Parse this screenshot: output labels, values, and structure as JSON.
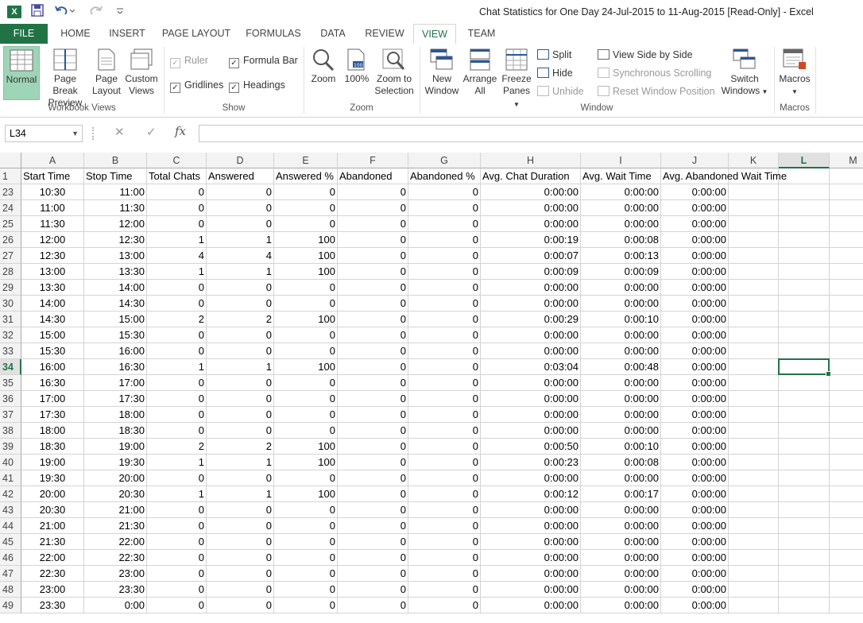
{
  "window": {
    "title": "Chat Statistics for One Day 24-Jul-2015 to 11-Aug-2015  [Read-Only] - Excel",
    "app_icon": "X"
  },
  "tabs": [
    "FILE",
    "HOME",
    "INSERT",
    "PAGE LAYOUT",
    "FORMULAS",
    "DATA",
    "REVIEW",
    "VIEW",
    "TEAM"
  ],
  "active_tab": "VIEW",
  "ribbon": {
    "workbook_views": {
      "label": "Workbook Views",
      "normal": "Normal",
      "page_break_1": "Page Break",
      "page_break_2": "Preview",
      "page_layout_1": "Page",
      "page_layout_2": "Layout",
      "custom_views_1": "Custom",
      "custom_views_2": "Views"
    },
    "show": {
      "label": "Show",
      "ruler": "Ruler",
      "gridlines": "Gridlines",
      "formula_bar": "Formula Bar",
      "headings": "Headings"
    },
    "zoom": {
      "label": "Zoom",
      "zoom": "Zoom",
      "zoom100": "100%",
      "zoom_sel_1": "Zoom to",
      "zoom_sel_2": "Selection"
    },
    "window": {
      "label": "Window",
      "new_1": "New",
      "new_2": "Window",
      "arrange_1": "Arrange",
      "arrange_2": "All",
      "freeze_1": "Freeze",
      "freeze_2": "Panes",
      "split": "Split",
      "hide": "Hide",
      "unhide": "Unhide",
      "side_by_side": "View Side by Side",
      "sync_scroll": "Synchronous Scrolling",
      "reset_pos": "Reset Window Position",
      "switch_1": "Switch",
      "switch_2": "Windows"
    },
    "macros": {
      "label": "Macros",
      "macros": "Macros"
    }
  },
  "formula_bar": {
    "name_box": "L34",
    "fx": "fx",
    "formula": ""
  },
  "columns": [
    "A",
    "B",
    "C",
    "D",
    "E",
    "F",
    "G",
    "H",
    "I",
    "J",
    "K",
    "L",
    "M"
  ],
  "selected_column": "L",
  "selected_row": "34",
  "header_row": {
    "row": "1",
    "cells": [
      "Start Time",
      "Stop Time",
      "Total Chats",
      "Answered",
      "Answered %",
      "Abandoned",
      "Abandoned %",
      "Avg. Chat Duration",
      "Avg. Wait Time",
      "Avg. Abandoned Wait Time"
    ]
  },
  "rows": [
    {
      "n": "23",
      "v": [
        "10:30",
        "11:00",
        "0",
        "0",
        "0",
        "0",
        "0",
        "0:00:00",
        "0:00:00",
        "0:00:00"
      ]
    },
    {
      "n": "24",
      "v": [
        "11:00",
        "11:30",
        "0",
        "0",
        "0",
        "0",
        "0",
        "0:00:00",
        "0:00:00",
        "0:00:00"
      ]
    },
    {
      "n": "25",
      "v": [
        "11:30",
        "12:00",
        "0",
        "0",
        "0",
        "0",
        "0",
        "0:00:00",
        "0:00:00",
        "0:00:00"
      ]
    },
    {
      "n": "26",
      "v": [
        "12:00",
        "12:30",
        "1",
        "1",
        "100",
        "0",
        "0",
        "0:00:19",
        "0:00:08",
        "0:00:00"
      ]
    },
    {
      "n": "27",
      "v": [
        "12:30",
        "13:00",
        "4",
        "4",
        "100",
        "0",
        "0",
        "0:00:07",
        "0:00:13",
        "0:00:00"
      ]
    },
    {
      "n": "28",
      "v": [
        "13:00",
        "13:30",
        "1",
        "1",
        "100",
        "0",
        "0",
        "0:00:09",
        "0:00:09",
        "0:00:00"
      ]
    },
    {
      "n": "29",
      "v": [
        "13:30",
        "14:00",
        "0",
        "0",
        "0",
        "0",
        "0",
        "0:00:00",
        "0:00:00",
        "0:00:00"
      ]
    },
    {
      "n": "30",
      "v": [
        "14:00",
        "14:30",
        "0",
        "0",
        "0",
        "0",
        "0",
        "0:00:00",
        "0:00:00",
        "0:00:00"
      ]
    },
    {
      "n": "31",
      "v": [
        "14:30",
        "15:00",
        "2",
        "2",
        "100",
        "0",
        "0",
        "0:00:29",
        "0:00:10",
        "0:00:00"
      ]
    },
    {
      "n": "32",
      "v": [
        "15:00",
        "15:30",
        "0",
        "0",
        "0",
        "0",
        "0",
        "0:00:00",
        "0:00:00",
        "0:00:00"
      ]
    },
    {
      "n": "33",
      "v": [
        "15:30",
        "16:00",
        "0",
        "0",
        "0",
        "0",
        "0",
        "0:00:00",
        "0:00:00",
        "0:00:00"
      ]
    },
    {
      "n": "34",
      "v": [
        "16:00",
        "16:30",
        "1",
        "1",
        "100",
        "0",
        "0",
        "0:03:04",
        "0:00:48",
        "0:00:00"
      ]
    },
    {
      "n": "35",
      "v": [
        "16:30",
        "17:00",
        "0",
        "0",
        "0",
        "0",
        "0",
        "0:00:00",
        "0:00:00",
        "0:00:00"
      ]
    },
    {
      "n": "36",
      "v": [
        "17:00",
        "17:30",
        "0",
        "0",
        "0",
        "0",
        "0",
        "0:00:00",
        "0:00:00",
        "0:00:00"
      ]
    },
    {
      "n": "37",
      "v": [
        "17:30",
        "18:00",
        "0",
        "0",
        "0",
        "0",
        "0",
        "0:00:00",
        "0:00:00",
        "0:00:00"
      ]
    },
    {
      "n": "38",
      "v": [
        "18:00",
        "18:30",
        "0",
        "0",
        "0",
        "0",
        "0",
        "0:00:00",
        "0:00:00",
        "0:00:00"
      ]
    },
    {
      "n": "39",
      "v": [
        "18:30",
        "19:00",
        "2",
        "2",
        "100",
        "0",
        "0",
        "0:00:50",
        "0:00:10",
        "0:00:00"
      ]
    },
    {
      "n": "40",
      "v": [
        "19:00",
        "19:30",
        "1",
        "1",
        "100",
        "0",
        "0",
        "0:00:23",
        "0:00:08",
        "0:00:00"
      ]
    },
    {
      "n": "41",
      "v": [
        "19:30",
        "20:00",
        "0",
        "0",
        "0",
        "0",
        "0",
        "0:00:00",
        "0:00:00",
        "0:00:00"
      ]
    },
    {
      "n": "42",
      "v": [
        "20:00",
        "20:30",
        "1",
        "1",
        "100",
        "0",
        "0",
        "0:00:12",
        "0:00:17",
        "0:00:00"
      ]
    },
    {
      "n": "43",
      "v": [
        "20:30",
        "21:00",
        "0",
        "0",
        "0",
        "0",
        "0",
        "0:00:00",
        "0:00:00",
        "0:00:00"
      ]
    },
    {
      "n": "44",
      "v": [
        "21:00",
        "21:30",
        "0",
        "0",
        "0",
        "0",
        "0",
        "0:00:00",
        "0:00:00",
        "0:00:00"
      ]
    },
    {
      "n": "45",
      "v": [
        "21:30",
        "22:00",
        "0",
        "0",
        "0",
        "0",
        "0",
        "0:00:00",
        "0:00:00",
        "0:00:00"
      ]
    },
    {
      "n": "46",
      "v": [
        "22:00",
        "22:30",
        "0",
        "0",
        "0",
        "0",
        "0",
        "0:00:00",
        "0:00:00",
        "0:00:00"
      ]
    },
    {
      "n": "47",
      "v": [
        "22:30",
        "23:00",
        "0",
        "0",
        "0",
        "0",
        "0",
        "0:00:00",
        "0:00:00",
        "0:00:00"
      ]
    },
    {
      "n": "48",
      "v": [
        "23:00",
        "23:30",
        "0",
        "0",
        "0",
        "0",
        "0",
        "0:00:00",
        "0:00:00",
        "0:00:00"
      ]
    },
    {
      "n": "49",
      "v": [
        "23:30",
        "0:00",
        "0",
        "0",
        "0",
        "0",
        "0",
        "0:00:00",
        "0:00:00",
        "0:00:00"
      ]
    }
  ],
  "colors": {
    "accent": "#217346",
    "header_bg": "#f3f3f3",
    "gridline": "#d4d4d4"
  }
}
